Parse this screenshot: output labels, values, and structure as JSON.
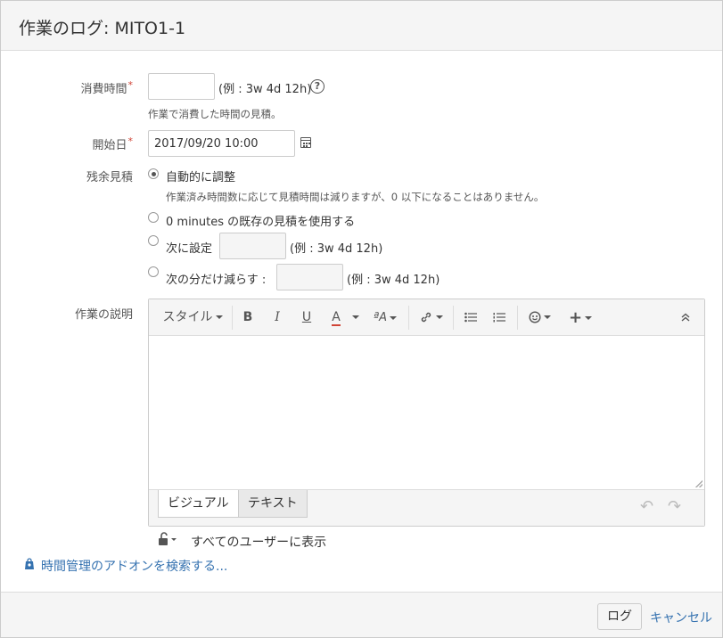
{
  "dialog": {
    "title": "作業のログ: MITO1-1"
  },
  "form": {
    "time_spent": {
      "label": "消費時間",
      "required_mark": "*",
      "value": "",
      "example": "(例 : 3w 4d 12h)",
      "description": "作業で消費した時間の見積。"
    },
    "start_date": {
      "label": "開始日",
      "required_mark": "*",
      "value": "2017/09/20 10:00"
    },
    "remaining": {
      "label": "残余見積",
      "options": [
        {
          "label": "自動的に調整",
          "checked": true,
          "description": "作業済み時間数に応じて見積時間は減りますが、0 以下になることはありません。"
        },
        {
          "label": "0 minutes の既存の見積を使用する",
          "checked": false
        },
        {
          "label": "次に設定",
          "checked": false,
          "example": "(例 : 3w 4d 12h)"
        },
        {
          "label": "次の分だけ減らす :",
          "checked": false,
          "example": "(例 : 3w 4d 12h)"
        }
      ]
    },
    "work_description": {
      "label": "作業の説明",
      "toolbar": {
        "style_label": "スタイル",
        "bold": "B",
        "italic": "I",
        "underline": "U",
        "text_color": "A",
        "format": "ªA"
      },
      "tabs": [
        "ビジュアル",
        "テキスト"
      ],
      "active_tab": "ビジュアル",
      "underline_color": "#d04437"
    },
    "visibility": "すべてのユーザーに表示",
    "addon_link": "時間管理のアドオンを検索する..."
  },
  "footer": {
    "log_button": "ログ",
    "cancel_link": "キャンセル"
  },
  "colors": {
    "link": "#3572b0",
    "required": "#d04437"
  }
}
